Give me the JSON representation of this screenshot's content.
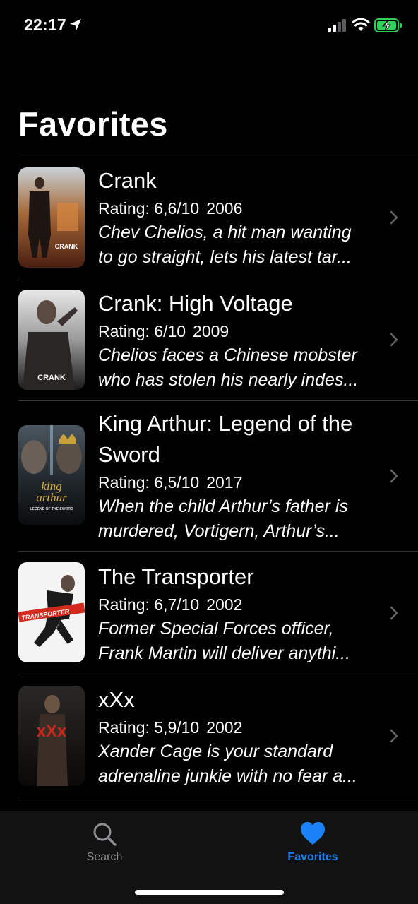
{
  "status_bar": {
    "time": "22:17",
    "icons": [
      "location-arrow-icon",
      "cellular-signal-icon",
      "wifi-icon",
      "battery-charging-icon"
    ]
  },
  "page": {
    "title": "Favorites"
  },
  "movies": [
    {
      "title": "Crank",
      "rating": "Rating: 6,6/10",
      "year": "2006",
      "desc_line1": "Chev Chelios, a hit man wanting",
      "desc_line2": "to go straight, lets his latest tar...",
      "poster_text": "CRANK"
    },
    {
      "title": "Crank: High Voltage",
      "rating": "Rating: 6/10",
      "year": "2009",
      "desc_line1": "Chelios faces a Chinese mobster",
      "desc_line2": "who has stolen his nearly indes...",
      "poster_text": "CRANK"
    },
    {
      "title_line1": "King Arthur: Legend of the",
      "title_line2": "Sword",
      "rating": "Rating: 6,5/10",
      "year": "2017",
      "desc_line1": "When the child Arthur’s father is",
      "desc_line2": "murdered, Vortigern, Arthur’s...",
      "poster_text_1": "king",
      "poster_text_2": "arthur",
      "poster_text_3": "LEGEND OF THE SWORD"
    },
    {
      "title": "The Transporter",
      "rating": "Rating: 6,7/10",
      "year": "2002",
      "desc_line1": "Former Special Forces officer,",
      "desc_line2": "Frank Martin will deliver anythi...",
      "poster_text": "TRANSPORTER"
    },
    {
      "title": "xXx",
      "rating": "Rating: 5,9/10",
      "year": "2002",
      "desc_line1": "Xander Cage is your standard",
      "desc_line2": "adrenaline junkie with no fear a...",
      "poster_text": "xXx"
    }
  ],
  "tab_bar": {
    "tabs": [
      {
        "label": "Search",
        "icon": "search-icon",
        "selected": false
      },
      {
        "label": "Favorites",
        "icon": "heart-icon",
        "selected": true
      }
    ],
    "accent_color": "#1a82f7"
  }
}
